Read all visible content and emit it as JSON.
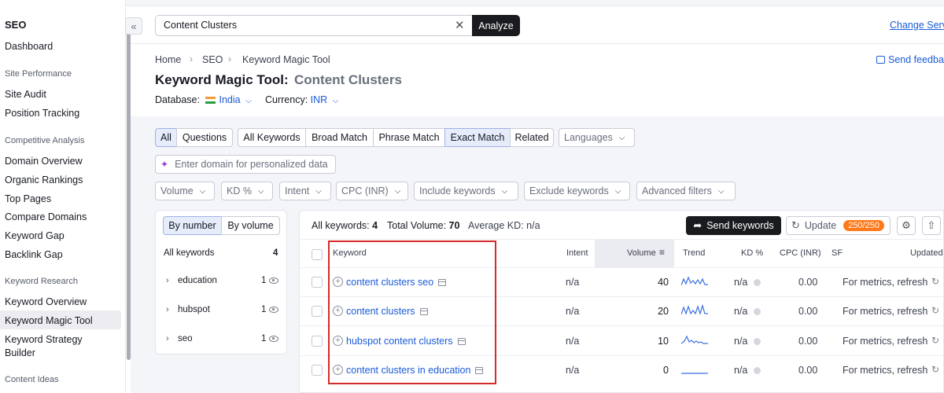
{
  "sidebar": {
    "title": "SEO",
    "dashboard": "Dashboard",
    "sections": [
      {
        "label": "Site Performance",
        "items": [
          "Site Audit",
          "Position Tracking"
        ]
      },
      {
        "label": "Competitive Analysis",
        "items": [
          "Domain Overview",
          "Organic Rankings",
          "Top Pages",
          "Compare Domains",
          "Keyword Gap",
          "Backlink Gap"
        ]
      },
      {
        "label": "Keyword Research",
        "items": [
          "Keyword Overview",
          "Keyword Magic Tool",
          "Keyword Strategy",
          "Builder"
        ]
      },
      {
        "label": "Content Ideas",
        "items": []
      }
    ],
    "active_item": "Keyword Magic Tool",
    "collapse_glyph": "«"
  },
  "topbar": {
    "search_value": "Content Clusters",
    "clear_glyph": "✕",
    "analyze_label": "Analyze",
    "change_link": "Change Serv"
  },
  "header": {
    "breadcrumb": [
      "Home",
      "SEO",
      "Keyword Magic Tool"
    ],
    "breadcrumb_sep": "›",
    "title": "Keyword Magic Tool:",
    "subtitle": "Content Clusters",
    "database_label": "Database:",
    "database_value": "India",
    "currency_label": "Currency:",
    "currency_value": "INR",
    "feedback_label": "Send feedba"
  },
  "filters": {
    "group1": [
      "All",
      "Questions"
    ],
    "group2": [
      "All Keywords",
      "Broad Match",
      "Phrase Match",
      "Exact Match",
      "Related"
    ],
    "languages": "Languages",
    "personalized_placeholder": "Enter domain for personalized data",
    "dropdowns": [
      "Volume",
      "KD %",
      "Intent",
      "CPC (INR)",
      "Include keywords",
      "Exclude keywords",
      "Advanced filters"
    ],
    "selected": [
      "All",
      "Exact Match"
    ]
  },
  "left_panel": {
    "toggle": [
      "By number",
      "By volume"
    ],
    "selected_toggle": "By number",
    "all_label": "All keywords",
    "all_count": "4",
    "groups": [
      {
        "name": "education",
        "count": "1"
      },
      {
        "name": "hubspot",
        "count": "1"
      },
      {
        "name": "seo",
        "count": "1"
      }
    ]
  },
  "summary": {
    "all_keywords_label": "All keywords:",
    "all_keywords_value": "4",
    "total_volume_label": "Total Volume:",
    "total_volume_value": "70",
    "avg_kd_label": "Average KD:",
    "avg_kd_value": "n/a",
    "send_label": "Send keywords",
    "update_label": "Update",
    "update_badge": "250/250"
  },
  "table": {
    "headers": [
      "Keyword",
      "Intent",
      "Volume",
      "Trend",
      "KD %",
      "CPC (INR)",
      "SF",
      "Updated"
    ],
    "rows": [
      {
        "keyword": "content clusters seo",
        "intent": "n/a",
        "volume": "40",
        "kd": "n/a",
        "cpc": "0.00",
        "updated": "For metrics, refresh"
      },
      {
        "keyword": "content clusters",
        "intent": "n/a",
        "volume": "20",
        "kd": "n/a",
        "cpc": "0.00",
        "updated": "For metrics, refresh"
      },
      {
        "keyword": "hubspot content clusters",
        "intent": "n/a",
        "volume": "10",
        "kd": "n/a",
        "cpc": "0.00",
        "updated": "For metrics, refresh"
      },
      {
        "keyword": "content clusters in education",
        "intent": "n/a",
        "volume": "0",
        "kd": "n/a",
        "cpc": "0.00",
        "updated": "For metrics, refresh"
      }
    ]
  },
  "colors": {
    "accent": "#1a5bd8",
    "highlight": "#d52a2a",
    "badge": "#ff7a1a"
  }
}
